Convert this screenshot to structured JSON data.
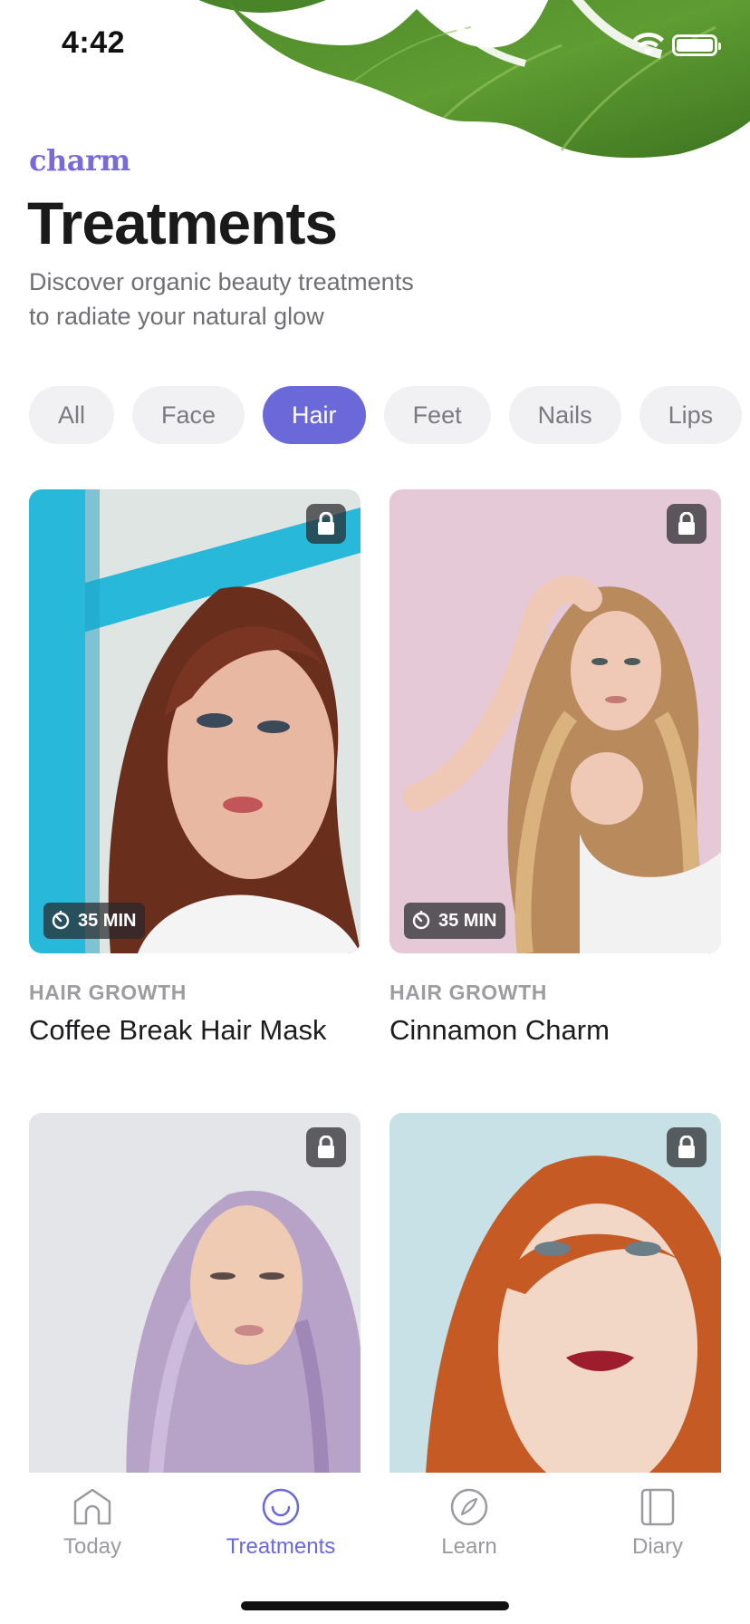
{
  "status_bar": {
    "time": "4:42"
  },
  "header": {
    "brand": "charm",
    "title": "Treatments",
    "subtitle_line1": "Discover organic beauty treatments",
    "subtitle_line2": "to radiate your natural glow"
  },
  "categories": {
    "items": [
      "All",
      "Face",
      "Hair",
      "Feet",
      "Nails",
      "Lips"
    ],
    "selected": "Hair"
  },
  "cards": [
    {
      "category": "HAIR GROWTH",
      "title": "Coffee Break Hair Mask",
      "duration": "35 MIN",
      "locked": true
    },
    {
      "category": "HAIR GROWTH",
      "title": "Cinnamon Charm",
      "duration": "35 MIN",
      "locked": true
    },
    {
      "locked": true
    },
    {
      "locked": true
    }
  ],
  "tab_bar": {
    "items": [
      {
        "label": "Today",
        "icon": "home-icon"
      },
      {
        "label": "Treatments",
        "icon": "smile-icon"
      },
      {
        "label": "Learn",
        "icon": "compass-icon"
      },
      {
        "label": "Diary",
        "icon": "book-icon"
      }
    ],
    "active": "Treatments"
  },
  "colors": {
    "accent": "#6b68da",
    "brand": "#7a6ad8",
    "chip_background": "#f1f1f3",
    "muted_text": "#9c9ca1"
  }
}
